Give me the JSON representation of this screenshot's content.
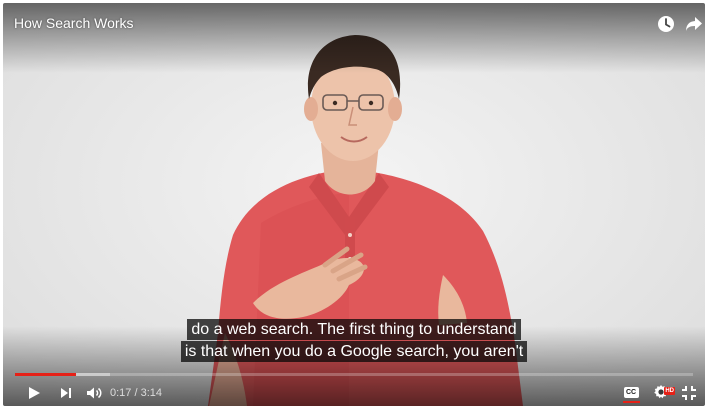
{
  "video": {
    "title": "How Search Works",
    "captions": [
      "do a web search. The first thing to understand",
      "is that when you do a Google search, you aren't"
    ],
    "current_time": "0:17",
    "duration": "3:14",
    "time_separator": " / ",
    "progress_fraction": 0.09,
    "buffered_fraction": 0.14
  },
  "icons": {
    "watch_later": "clock-icon",
    "share": "share-arrow-icon",
    "play": "play-icon",
    "next": "next-icon",
    "volume": "volume-icon",
    "captions": "cc-icon",
    "settings": "gear-icon",
    "exit_fullscreen": "exit-fullscreen-icon"
  },
  "cc_label": "CC",
  "hd_label": "HD",
  "colors": {
    "progress_played": "#e62117",
    "shirt": "#e0585a",
    "background": "#e9e9e9"
  }
}
